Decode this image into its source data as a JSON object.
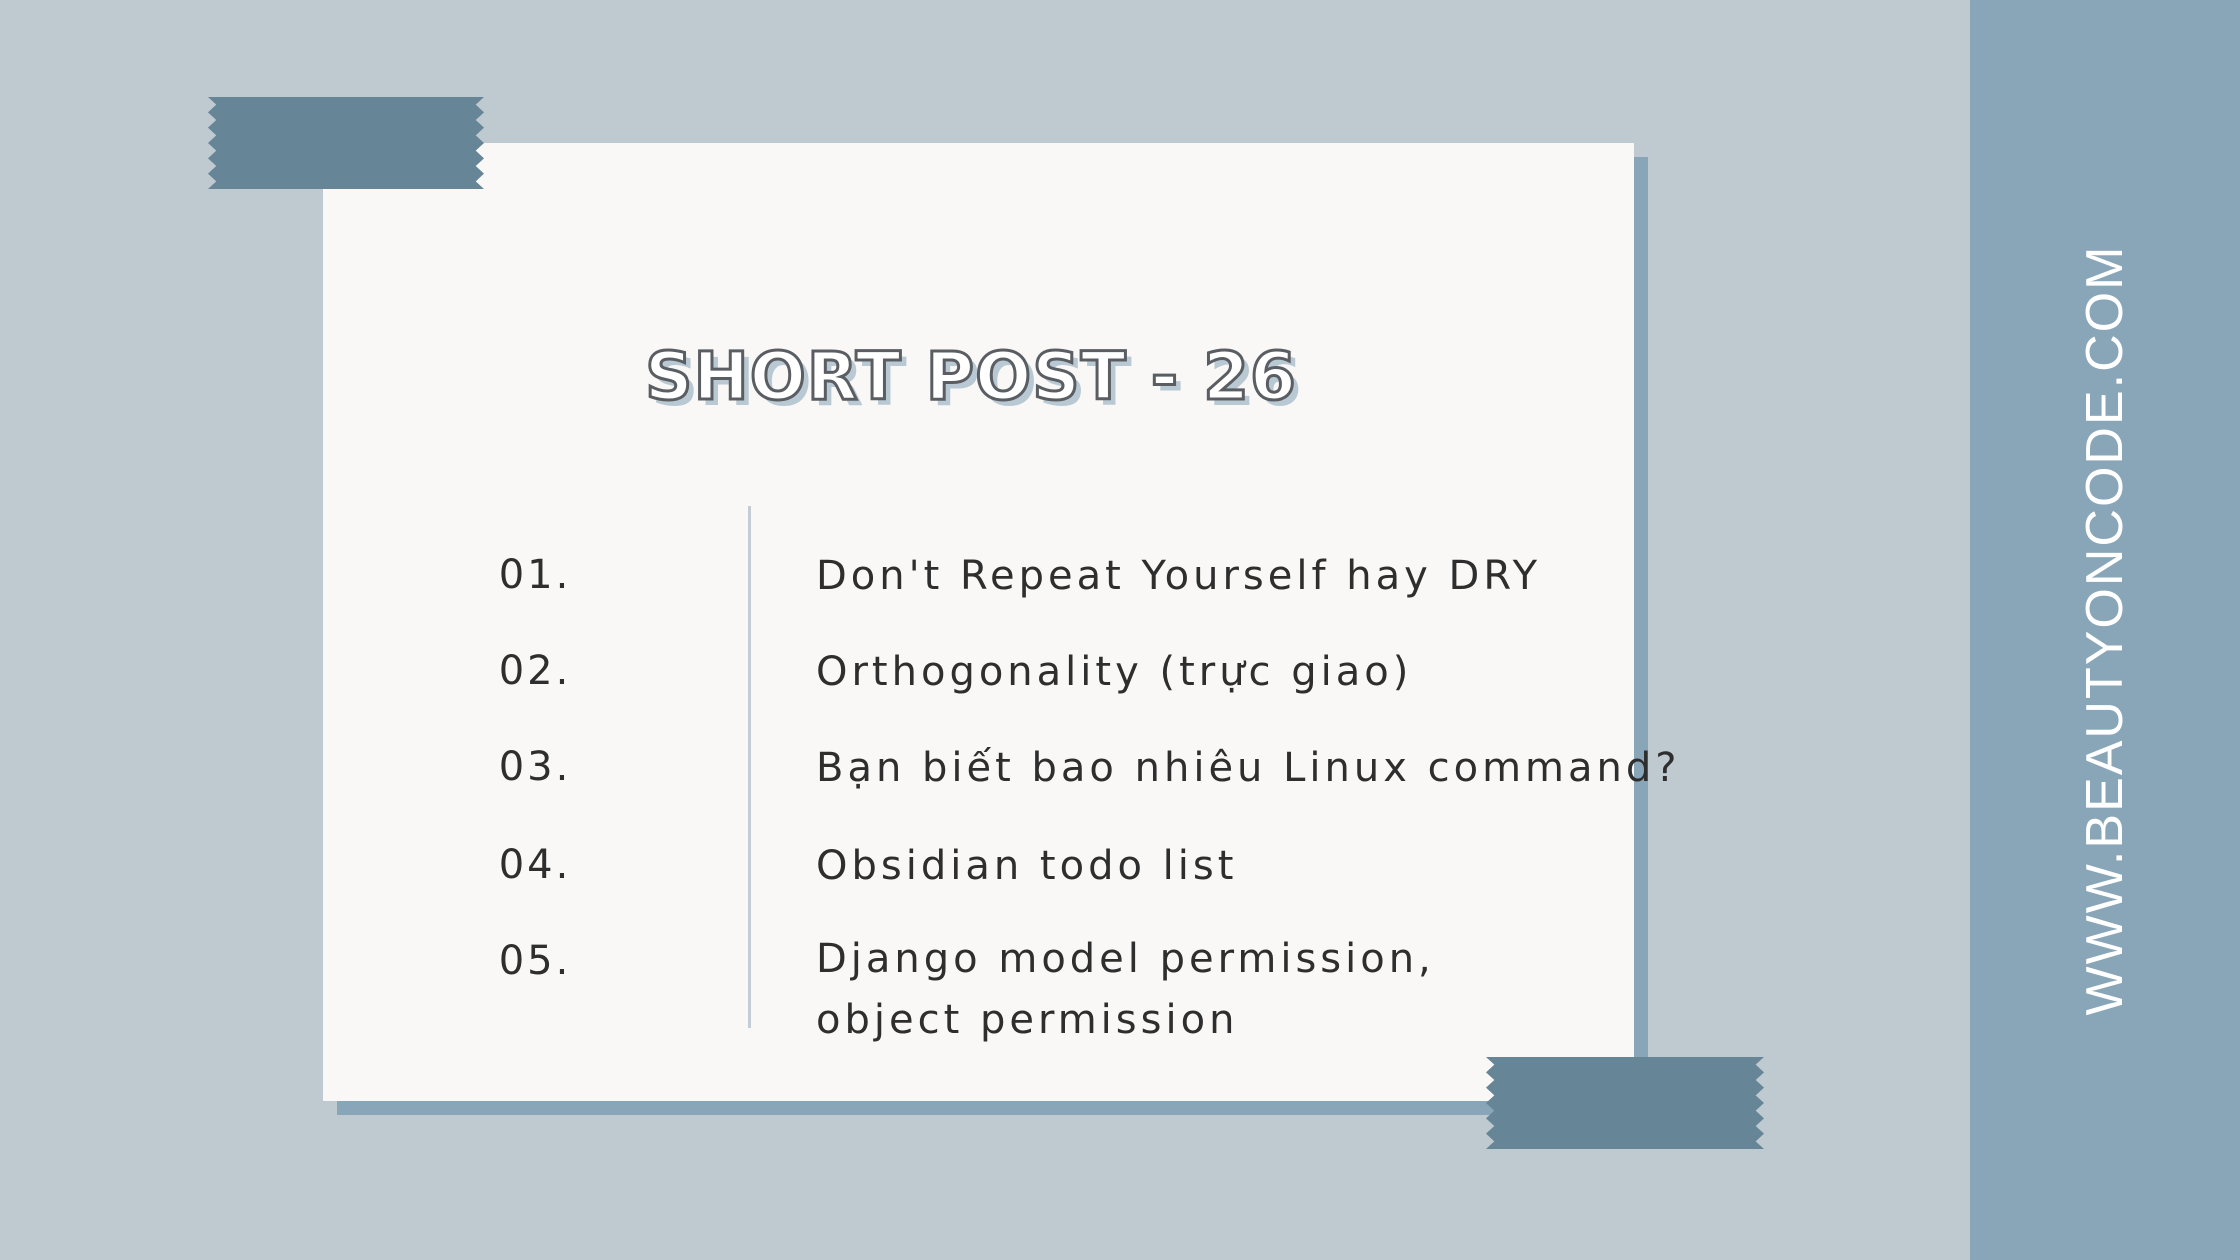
{
  "title": "SHORT POST - 26",
  "website": "WWW.BEAUTYONCODE.COM",
  "items": [
    {
      "number": "01.",
      "text": "Don't Repeat Yourself hay DRY"
    },
    {
      "number": "02.",
      "text": "Orthogonality (trực giao)"
    },
    {
      "number": "03.",
      "text": "Bạn biết bao nhiêu Linux command?"
    },
    {
      "number": "04.",
      "text": "Obsidian todo list"
    },
    {
      "number": "05.",
      "text_line1": "Django model permission,",
      "text_line2": "object permission"
    }
  ],
  "colors": {
    "background": "#bec9d0",
    "sidebar": "#89a6b8",
    "card": "#f9f8f7",
    "tape": "#668596",
    "text": "#2e2e2e"
  }
}
